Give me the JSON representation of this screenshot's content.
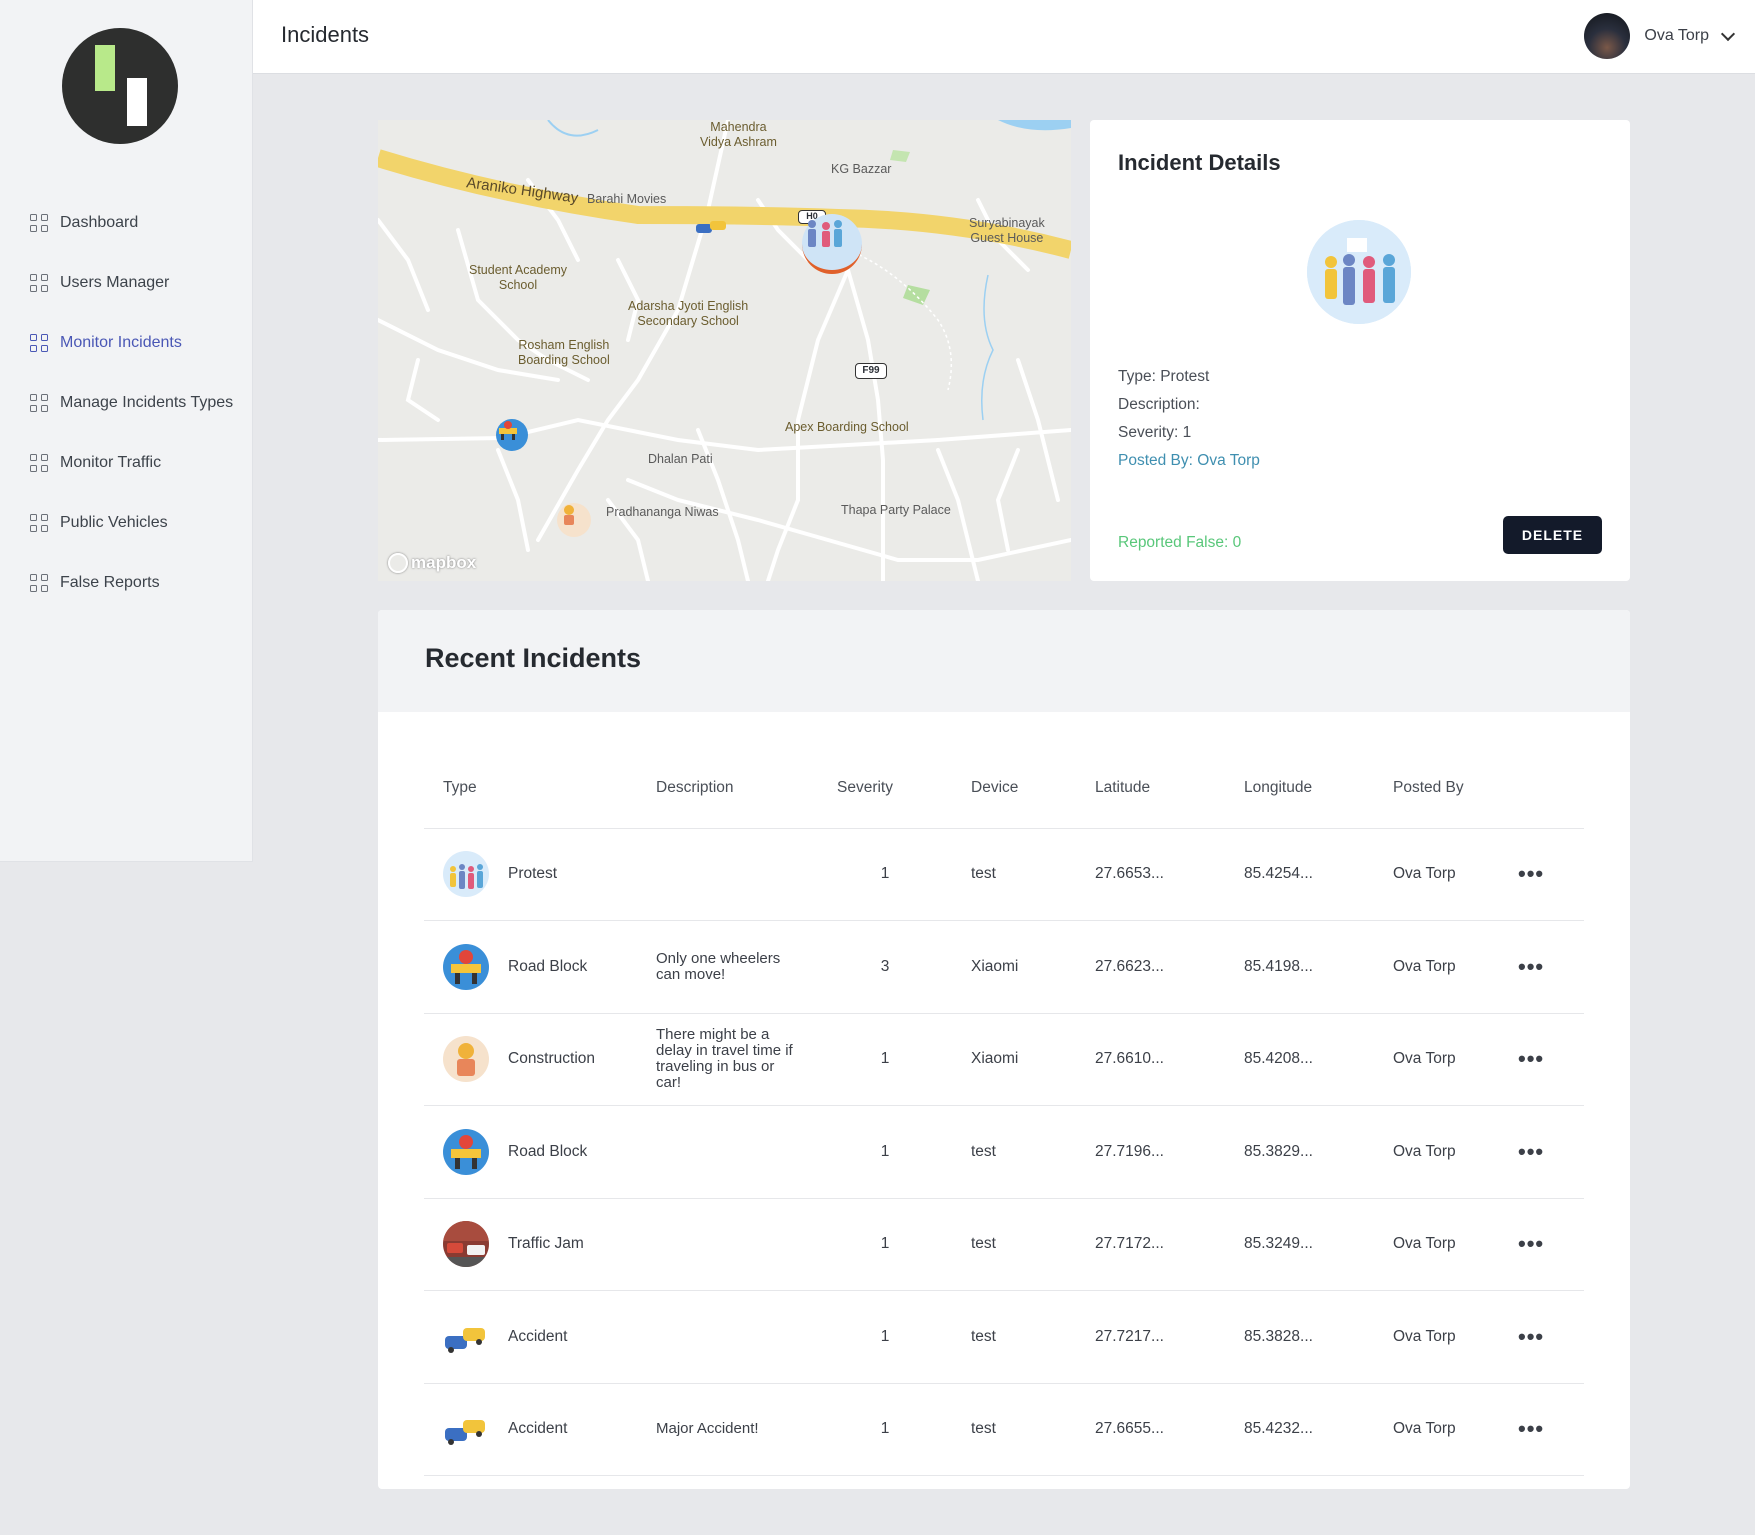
{
  "sidebar": {
    "items": [
      {
        "label": "Dashboard"
      },
      {
        "label": "Users Manager"
      },
      {
        "label": "Monitor Incidents"
      },
      {
        "label": "Manage Incidents Types"
      },
      {
        "label": "Monitor Traffic"
      },
      {
        "label": "Public Vehicles"
      },
      {
        "label": "False Reports"
      }
    ],
    "active": "Monitor Incidents"
  },
  "header": {
    "title": "Incidents",
    "user_name": "Ova Torp"
  },
  "map": {
    "labels": {
      "mahendra": "Mahendra\nVidya Ashram",
      "kg_bazzar": "KG Bazzar",
      "araniko": "Araniko Highway",
      "barahi": "Barahi Movies",
      "suryabinayak": "Suryabinayak\nGuest House",
      "student_academy": "Student Academy\nSchool",
      "adarsha": "Adarsha Jyoti English\nSecondary School",
      "rosham": "Rosham English\nBoarding School",
      "apex": "Apex Boarding School",
      "dhalan": "Dhalan Pati",
      "pradhananga": "Pradhananga Niwas",
      "thapa": "Thapa Party Palace",
      "shield_f99": "F99",
      "shield_h0": "H0",
      "attribution": "mapbox"
    }
  },
  "details": {
    "title": "Incident Details",
    "type": "Type: Protest",
    "description": "Description:",
    "severity": "Severity: 1",
    "posted_by": "Posted By: Ova Torp",
    "reported_false": "Reported False: 0",
    "delete_label": "DELETE"
  },
  "recent": {
    "title": "Recent Incidents",
    "columns": [
      "Type",
      "Description",
      "Severity",
      "Device",
      "Latitude",
      "Longitude",
      "Posted By"
    ],
    "more_label": "•••",
    "rows": [
      {
        "type": "Protest",
        "description": "",
        "severity": "1",
        "device": "test",
        "latitude": "27.6653...",
        "longitude": "85.4254...",
        "posted_by": "Ova Torp",
        "icon": "protest-icon"
      },
      {
        "type": "Road Block",
        "description": "Only one wheelers can move!",
        "severity": "3",
        "device": "Xiaomi",
        "latitude": "27.6623...",
        "longitude": "85.4198...",
        "posted_by": "Ova Torp",
        "icon": "road-block-icon"
      },
      {
        "type": "Construction",
        "description": "There might be a delay in travel time if traveling in bus or car!",
        "severity": "1",
        "device": "Xiaomi",
        "latitude": "27.6610...",
        "longitude": "85.4208...",
        "posted_by": "Ova Torp",
        "icon": "construction-icon"
      },
      {
        "type": "Road Block",
        "description": "",
        "severity": "1",
        "device": "test",
        "latitude": "27.7196...",
        "longitude": "85.3829...",
        "posted_by": "Ova Torp",
        "icon": "road-block-icon"
      },
      {
        "type": "Traffic Jam",
        "description": "",
        "severity": "1",
        "device": "test",
        "latitude": "27.7172...",
        "longitude": "85.3249...",
        "posted_by": "Ova Torp",
        "icon": "traffic-jam-icon"
      },
      {
        "type": "Accident",
        "description": "",
        "severity": "1",
        "device": "test",
        "latitude": "27.7217...",
        "longitude": "85.3828...",
        "posted_by": "Ova Torp",
        "icon": "accident-icon"
      },
      {
        "type": "Accident",
        "description": "Major Accident!",
        "severity": "1",
        "device": "test",
        "latitude": "27.6655...",
        "longitude": "85.4232...",
        "posted_by": "Ova Torp",
        "icon": "accident-icon"
      }
    ]
  },
  "colors": {
    "accent": "#4a57b5",
    "posted_by": "#3f8fb0",
    "reported_false": "#59c77a",
    "delete_button": "#131a2a",
    "highway": "#f2d46b"
  }
}
